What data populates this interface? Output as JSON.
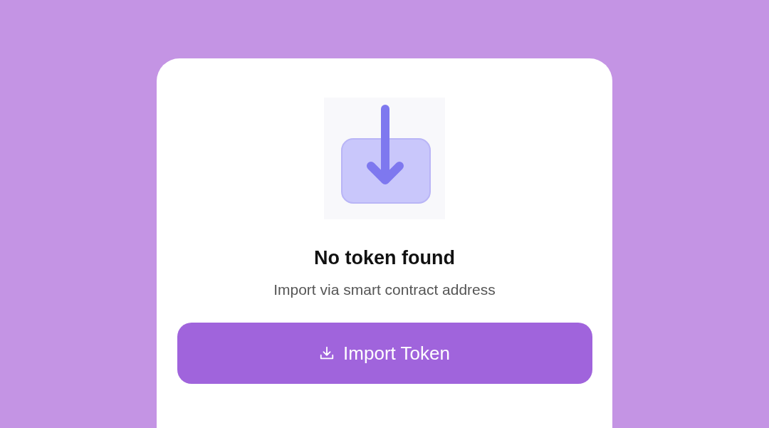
{
  "empty_state": {
    "title": "No token found",
    "subtitle": "Import via smart contract address"
  },
  "button": {
    "label": "Import Token"
  }
}
